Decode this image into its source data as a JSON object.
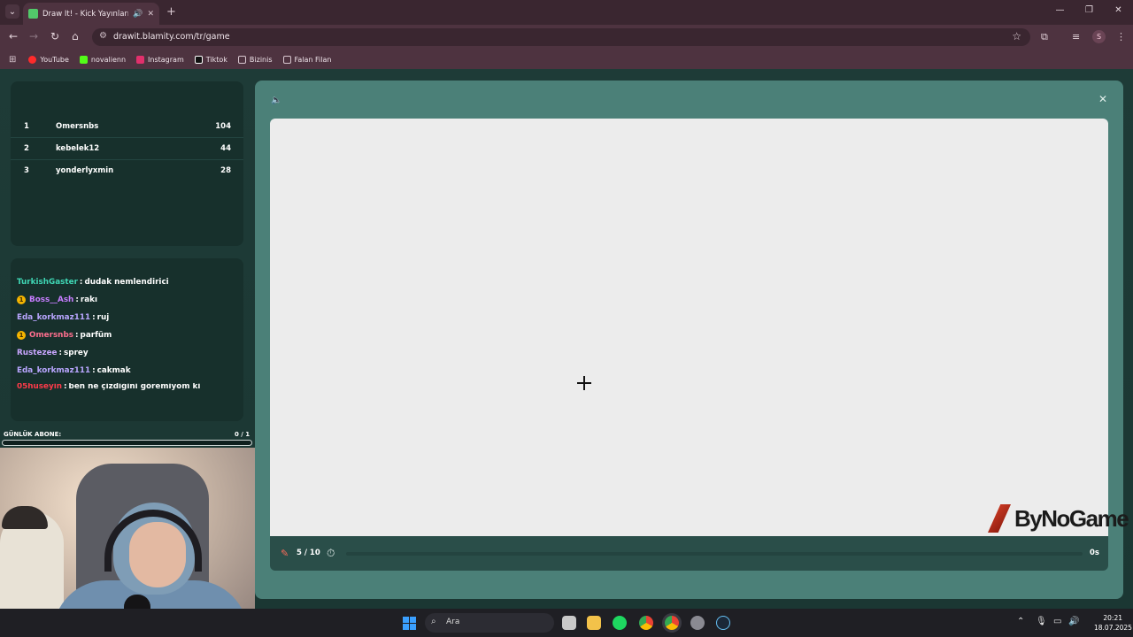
{
  "browser": {
    "tab_title": "Draw It! - Kick Yayınları İçin",
    "url": "drawit.blamity.com/tr/game",
    "profile_initial": "S",
    "bookmarks": [
      {
        "label": "YouTube",
        "color": "#ff2b2b"
      },
      {
        "label": "novalienn",
        "color": "#53fc18"
      },
      {
        "label": "Instagram",
        "color": "#e1306c"
      },
      {
        "label": "Tiktok",
        "color": "#ffffff"
      },
      {
        "label": "Bizinis",
        "color": "#d8c7cf"
      },
      {
        "label": "Falan Filan",
        "color": "#d8c7cf"
      }
    ]
  },
  "leaderboard": [
    {
      "rank": "1",
      "name": "Omersnbs",
      "score": "104"
    },
    {
      "rank": "2",
      "name": "kebelek12",
      "score": "44"
    },
    {
      "rank": "3",
      "name": "yonderlyxmin",
      "score": "28"
    }
  ],
  "chat": [
    {
      "user": "TurkishGaster",
      "message": "dudak nemlendirici",
      "color": "#3fd7b5",
      "badge": false
    },
    {
      "user": "Boss__Ash",
      "message": "rakı",
      "color": "#c77dff",
      "badge": true
    },
    {
      "user": "Eda_korkmaz111",
      "message": "ruj",
      "color": "#b9a6ff",
      "badge": false
    },
    {
      "user": "Omersnbs",
      "message": "parfüm",
      "color": "#ff6f8e",
      "badge": true
    },
    {
      "user": "Rustezee",
      "message": "sprey",
      "color": "#c9a6ff",
      "badge": false
    },
    {
      "user": "Eda_korkmaz111",
      "message": "cakmak",
      "color": "#b9a6ff",
      "badge": false
    },
    {
      "user": "05huseyin",
      "message": "ben ne çizdiğini göremiyom ki",
      "color": "#ff3b4a",
      "badge": false
    }
  ],
  "subscription": {
    "label": "GÜNLÜK ABONE:",
    "count": "0  / 1",
    "progress": 0.0
  },
  "game": {
    "round": "5 / 10",
    "timer": "0s",
    "watermark": "ByNoGame"
  },
  "taskbar": {
    "search_placeholder": "Ara",
    "time": "20:21",
    "date": "18.07.2025"
  },
  "icons": {
    "sound": "speaker-icon",
    "close": "close-icon",
    "pencil": "pencil-icon",
    "timer": "stopwatch-icon"
  }
}
